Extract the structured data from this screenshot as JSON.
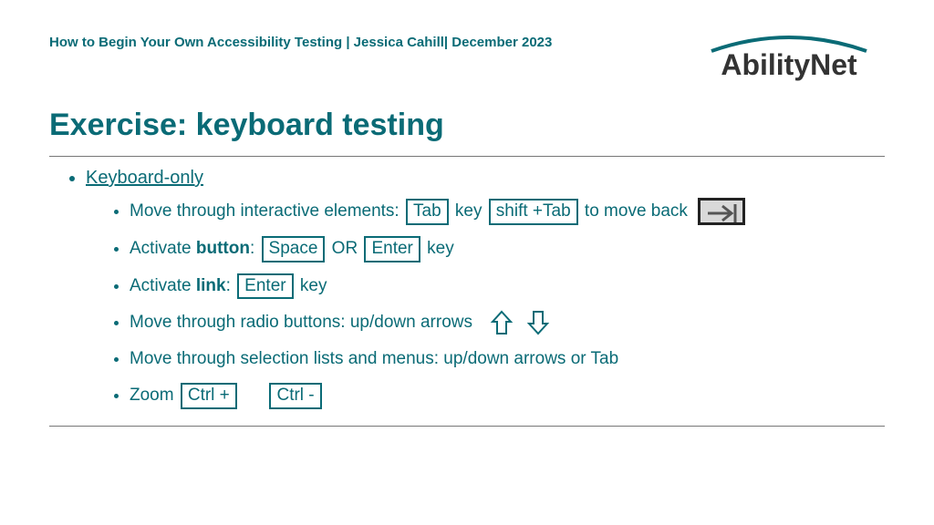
{
  "header": {
    "breadcrumb": "How to Begin Your Own Accessibility Testing | Jessica Cahill| December 2023",
    "logo": "AbilityNet"
  },
  "title": "Exercise: keyboard testing",
  "outer_label": "Keyboard-only",
  "items": {
    "i1": {
      "pre": "Move through interactive elements:",
      "key1": "Tab",
      "mid1": " key",
      "key2": "shift +Tab",
      "mid2": " to move back"
    },
    "i2": {
      "pre": "Activate ",
      "bold": "button",
      "post": ": ",
      "key1": "Space",
      "mid": "  OR ",
      "key2": "Enter",
      "tail": "  key"
    },
    "i3": {
      "pre": "Activate ",
      "bold": "link",
      "post": ": ",
      "key1": "Enter",
      "tail": "  key"
    },
    "i4": {
      "text": "Move through radio buttons: up/down arrows"
    },
    "i5": {
      "text": "Move through selection lists and menus: up/down arrows or Tab"
    },
    "i6": {
      "pre": "Zoom  ",
      "key1": "Ctrl +",
      "gap": "      ",
      "key2": "Ctrl -"
    }
  }
}
